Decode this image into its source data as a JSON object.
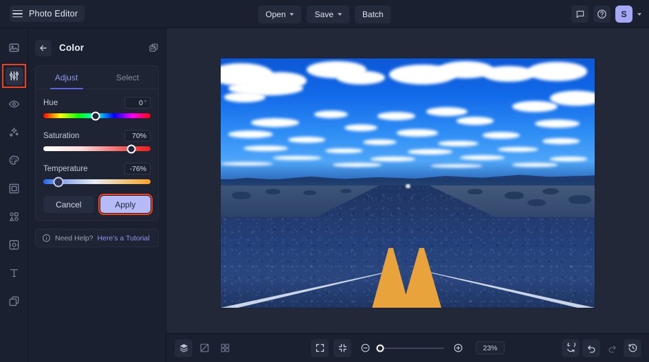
{
  "app": {
    "title": "Photo Editor",
    "menu_icon": "hamburger-icon"
  },
  "topbar": {
    "buttons": [
      {
        "label": "Open",
        "has_caret": true
      },
      {
        "label": "Save",
        "has_caret": true
      },
      {
        "label": "Batch",
        "has_caret": false
      }
    ],
    "right": {
      "feedback_icon": "comment-icon",
      "help_icon": "question-circle-icon",
      "avatar_initial": "S",
      "account_caret": "chevron-down-icon"
    }
  },
  "rail": {
    "items": [
      {
        "name": "image-icon",
        "active": false
      },
      {
        "name": "adjust-sliders-icon",
        "active": true
      },
      {
        "name": "eye-icon",
        "active": false
      },
      {
        "name": "sparkles-icon",
        "active": false
      },
      {
        "name": "palette-icon",
        "active": false
      },
      {
        "name": "frame-icon",
        "active": false
      },
      {
        "name": "shapes-icon",
        "active": false
      },
      {
        "name": "crop-rotate-icon",
        "active": false
      },
      {
        "name": "text-icon",
        "active": false
      },
      {
        "name": "layers-copy-icon",
        "active": false
      }
    ]
  },
  "panel": {
    "back_icon": "arrow-left-icon",
    "title": "Color",
    "duplicate_icon": "copy-layers-icon",
    "tabs": [
      {
        "label": "Adjust",
        "active": true
      },
      {
        "label": "Select",
        "active": false
      }
    ],
    "sliders": [
      {
        "label": "Hue",
        "value": "0",
        "unit": "°",
        "position_pct": 49,
        "type": "hue"
      },
      {
        "label": "Saturation",
        "value": "70%",
        "unit": "",
        "position_pct": 82,
        "type": "sat"
      },
      {
        "label": "Temperature",
        "value": "-76%",
        "unit": "",
        "position_pct": 14,
        "type": "temp"
      }
    ],
    "cancel_label": "Cancel",
    "apply_label": "Apply",
    "help": {
      "icon": "info-circle-icon",
      "text": "Need Help?",
      "link": "Here's a Tutorial"
    }
  },
  "bottombar": {
    "left_icons": [
      {
        "name": "layers-stack-icon",
        "filled": true
      },
      {
        "name": "compare-split-icon",
        "filled": false
      },
      {
        "name": "grid-view-icon",
        "filled": false
      }
    ],
    "center": {
      "fit_screen_icon": "fit-to-screen-icon",
      "actual_size_icon": "shrink-icon",
      "zoom_out_icon": "zoom-out-icon",
      "zoom_in_icon": "zoom-in-icon",
      "zoom_value": "23%",
      "slider_position_pct": 2
    },
    "right_icons": [
      {
        "name": "reset-rotate-icon",
        "filled": true
      },
      {
        "name": "undo-icon",
        "filled": true
      },
      {
        "name": "redo-icon",
        "filled": false
      },
      {
        "name": "history-icon",
        "filled": true
      }
    ]
  },
  "colors": {
    "accent": "#8e95ef",
    "apply_button": "#b6bbf8",
    "highlight_outline": "#f4411c",
    "panel_bg": "#1b2030",
    "canvas_bg": "#222838"
  },
  "canvas": {
    "image_alt": "desert-highway-photo"
  }
}
